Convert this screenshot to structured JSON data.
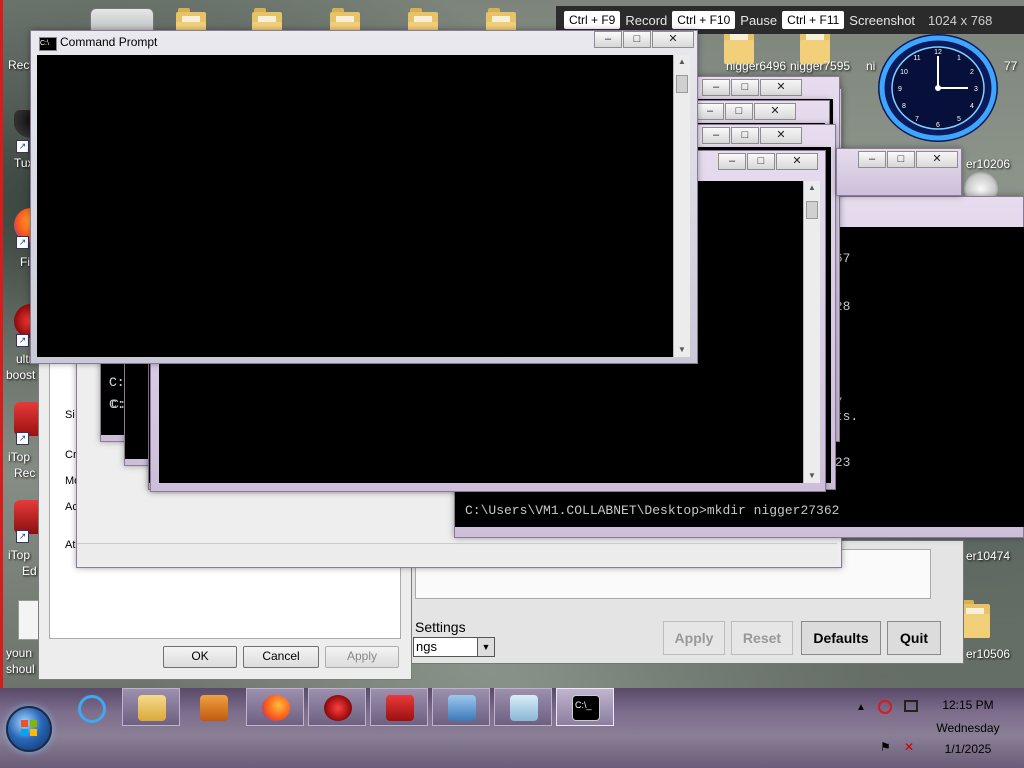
{
  "recorder": {
    "record_key": "Ctrl + F9",
    "record_label": "Record",
    "pause_key": "Ctrl + F10",
    "pause_label": "Pause",
    "screenshot_key": "Ctrl + F11",
    "screenshot_label": "Screenshot",
    "resolution": "1024 x 768"
  },
  "desktop": {
    "icons": {
      "recycle": "Recy",
      "tux": "Tux",
      "firefox": "Fir",
      "ultra_1": "ultr",
      "ultra_2": "boost",
      "itop_rec_1": "iTop",
      "itop_rec_2": "Rec",
      "itop_ed_1": "iTop",
      "itop_ed_2": "Ed",
      "doc_1": "youn",
      "doc_2": "shoul"
    },
    "folder_labels": {
      "a": "nigger6496",
      "b": "nigger7595",
      "c": "ni",
      "d": "77",
      "e": "er10206",
      "f": "er10474",
      "g": "er10506"
    }
  },
  "front_cmd": {
    "title": "Command Prompt",
    "minimize": "–",
    "maximize": "□",
    "close": "✕"
  },
  "back_cmd": {
    "line_1": "267",
    "line_2": "528",
    "line_3": "l",
    "line_4": "87",
    "line_5": "ets.",
    "line_6": "423",
    "prompt_line": "C:\\Users\\VM1.COLLABNET\\Desktop>mkdir nigger27362"
  },
  "stacked_cmd": {
    "prompt_a": "C:",
    "prompt_b": "C:",
    "prompt_c": "C:",
    "prompt_d": "C:"
  },
  "prop_dialog": {
    "side_items": [
      "Si",
      "Cr",
      "Mo",
      "Ac",
      "At"
    ],
    "ok": "OK",
    "cancel": "Cancel",
    "apply": "Apply"
  },
  "settings_win": {
    "section": "Settings",
    "combo_value": "ngs",
    "apply": "Apply",
    "reset": "Reset",
    "defaults": "Defaults",
    "quit": "Quit"
  },
  "taskbar": {
    "time": "12:15 PM",
    "day": "Wednesday",
    "date": "1/1/2025"
  },
  "colors": {
    "console_bg": "#000000",
    "window_frame": "#d8cbe0",
    "taskbar": "#7d6d8c",
    "recorder_bar": "#2b2b2b"
  }
}
